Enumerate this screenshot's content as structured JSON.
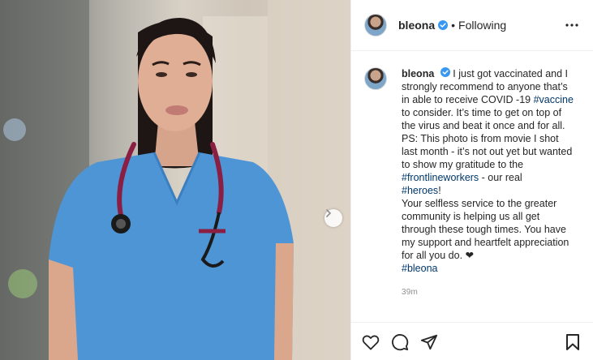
{
  "post": {
    "username": "bleona",
    "separator": "•",
    "follow_status": "Following",
    "caption": {
      "username": "bleona",
      "lines": [
        {
          "text": "I just got vaccinated and I strongly recommend to anyone that’s in able to receive COVID -19 ",
          "tag": "#vaccine",
          "after": " to consider. It’s time to get on top of the virus and beat it once and for all."
        },
        {
          "text": "PS: This photo is from movie I shot last month - it’s not out yet but wanted to show my gratitude to the ",
          "tag": "#frontlineworkers",
          "after": " - our real "
        },
        {
          "text": "",
          "tag": "#heroes",
          "after": "!"
        },
        {
          "text": "Your selfless service to the greater community is helping us all get through these tough times. You have my support and heartfelt appreciation for all you do. ❤",
          "tag": "",
          "after": ""
        },
        {
          "text": "",
          "tag": "#bleona",
          "after": ""
        }
      ]
    },
    "timestamp": "39m"
  },
  "icons": {
    "verified": "verified-badge-icon",
    "more": "more-options-icon",
    "next": "chevron-right-icon",
    "like": "heart-icon",
    "comment": "comment-icon",
    "share": "paper-plane-icon",
    "save": "bookmark-icon"
  },
  "colors": {
    "verified_blue": "#3897f0",
    "hashtag": "#00376b",
    "scrubs_blue": "#4e95d6",
    "stethoscope": "#8a1f43"
  }
}
